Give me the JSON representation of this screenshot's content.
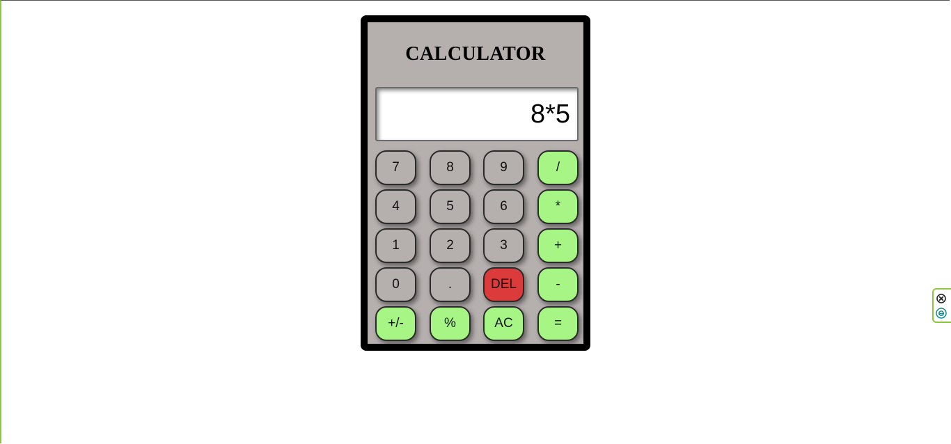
{
  "calculator": {
    "title": "CALCULATOR",
    "display_value": "8*5",
    "keys": [
      [
        "7",
        "8",
        "9",
        "/"
      ],
      [
        "4",
        "5",
        "6",
        "*"
      ],
      [
        "1",
        "2",
        "3",
        "+"
      ],
      [
        "0",
        ".",
        "DEL",
        "-"
      ],
      [
        "+/-",
        "%",
        "AC",
        "="
      ]
    ],
    "colors": {
      "body": "#b5afae",
      "frame": "#000000",
      "operator_key": "#a6f585",
      "delete_key": "#db3b3b",
      "number_key": "#b5afae"
    }
  },
  "extension_widget": {
    "icons": [
      "close-circle-icon",
      "edge-e-icon"
    ],
    "accent": "#8cc63f"
  }
}
